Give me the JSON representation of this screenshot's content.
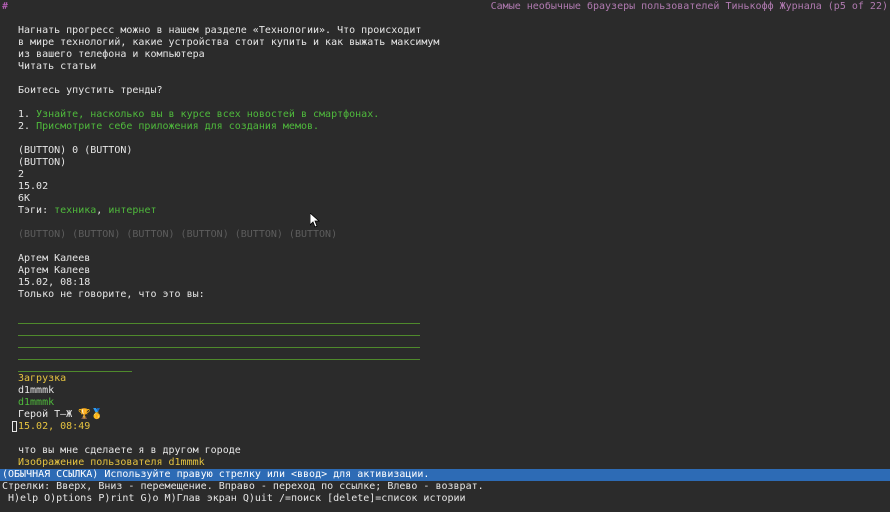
{
  "header": {
    "hash": "#",
    "title": "Самые необычные браузеры пользователей Тинькофф Журнала (p5 of 22)"
  },
  "article": {
    "intro_lines": [
      "Нагнать прогресс можно в нашем разделе «Технологии». Что происходит",
      "в мире технологий, какие устройства стоит купить и как выжать максимум",
      "из вашего телефона и компьютера"
    ],
    "read_link": "Читать статьи",
    "question": "Боитесь упустить тренды?",
    "list": [
      {
        "num": "1. ",
        "text": "Узнайте, насколько вы в курсе всех новостей в смартфонах."
      },
      {
        "num": "2. ",
        "text": "Присмотрите себе приложения для создания мемов."
      }
    ],
    "button_row1": "(BUTTON) 0 (BUTTON)",
    "button_row2": "(BUTTON)",
    "count": "2",
    "date": "15.02",
    "views": "6K",
    "tags_label": "Тэги: ",
    "tag1": "техника",
    "tag_sep": ", ",
    "tag2": "интернет",
    "share_buttons": "(BUTTON) (BUTTON) (BUTTON) (BUTTON) (BUTTON) (BUTTON)"
  },
  "comment1": {
    "author1": "Артем Калеев",
    "author2": "Артем Калеев",
    "datetime": "15.02, 08:18",
    "text": "Только не говорите, что это вы:"
  },
  "comment2": {
    "loading": "Загрузка",
    "user": "d1mmmk",
    "user_link": "d1mmmk",
    "badge": "Герой Т—Ж",
    "trophy": "🏆",
    "medal": "🥇",
    "datetime": "15.02, 08:49",
    "text": "что вы мне сделаете я в другом городе",
    "image_alt": "Изображение пользователя d1mmmk"
  },
  "status": {
    "message": "(ОБЫЧНАЯ ССЫЛКА) Используйте правую стрелку или <ввод> для активизации.",
    "help1": "Стрелки: Вверх, Вниз - перемещение. Вправо - переход по ссылке; Влево - возврат.",
    "help2": " H)elp O)ptions P)rint G)o M)Глав экран Q)uit /=поиск [delete]=список истории"
  }
}
